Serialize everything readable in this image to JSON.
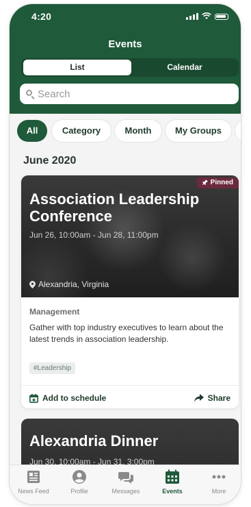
{
  "status_bar": {
    "time": "4:20"
  },
  "header": {
    "title": "Events"
  },
  "view_toggle": {
    "list_label": "List",
    "calendar_label": "Calendar"
  },
  "search": {
    "placeholder": "Search"
  },
  "filters": [
    {
      "label": "All",
      "active": true
    },
    {
      "label": "Category",
      "active": false
    },
    {
      "label": "Month",
      "active": false
    },
    {
      "label": "My Groups",
      "active": false
    }
  ],
  "section": {
    "title": "June 2020"
  },
  "events": [
    {
      "badge": "Pinned",
      "title": "Association Leadership Conference",
      "dates": "Jun 26, 10:00am - Jun 28, 11:00pm",
      "location": "Alexandria, Virginia",
      "category": "Management",
      "description": "Gather with top industry executives to learn about the latest trends in association leadership.",
      "tag": "#Leadership",
      "actions": {
        "add": "Add to schedule",
        "share": "Share"
      }
    },
    {
      "title": "Alexandria Dinner",
      "dates": "Jun 30, 10:00am - Jun 31, 3:00pm"
    }
  ],
  "tabbar": [
    {
      "label": "News Feed",
      "icon": "newspaper-icon",
      "active": false
    },
    {
      "label": "Profile",
      "icon": "profile-icon",
      "active": false
    },
    {
      "label": "Messages",
      "icon": "messages-icon",
      "active": false
    },
    {
      "label": "Events",
      "icon": "calendar-icon",
      "active": true
    },
    {
      "label": "More",
      "icon": "more-icon",
      "active": false
    }
  ],
  "colors": {
    "brand": "#1f5a3a",
    "pinned": "#6b2a3d"
  }
}
